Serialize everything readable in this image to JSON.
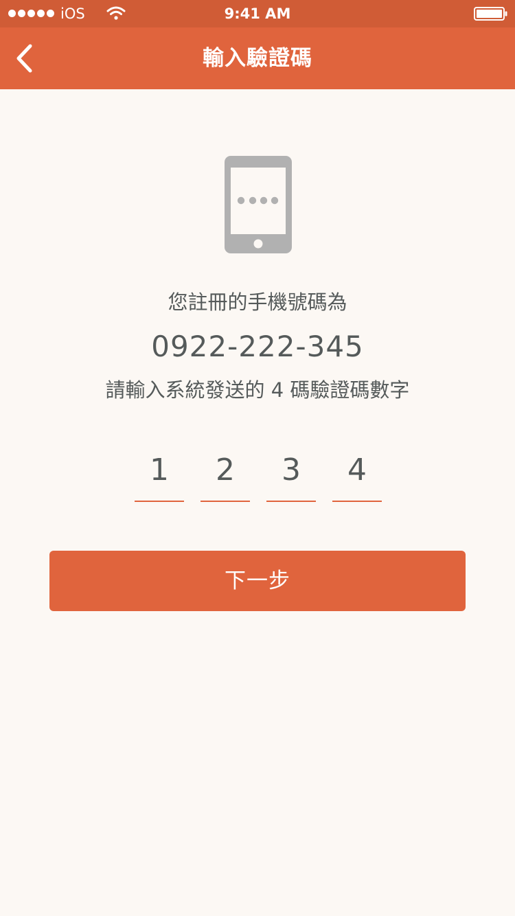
{
  "status_bar": {
    "carrier": "iOS",
    "time": "9:41 AM",
    "signal_bars": 5
  },
  "nav": {
    "back_icon": "chevron-left-icon",
    "title": "輸入驗證碼"
  },
  "content": {
    "device_icon": "smartphone-icon",
    "registered_label": "您註冊的手機號碼為",
    "phone_number": "0922-222-345",
    "instruction": "請輸入系統發送的 4 碼驗證碼數字"
  },
  "code": {
    "digits": [
      "1",
      "2",
      "3",
      "4"
    ]
  },
  "actions": {
    "next_label": "下一步"
  },
  "colors": {
    "accent": "#e0643d",
    "status_bar": "#d05c36",
    "background": "#fcf8f4",
    "text": "#555a5a",
    "icon_gray": "#b1b1b1"
  }
}
